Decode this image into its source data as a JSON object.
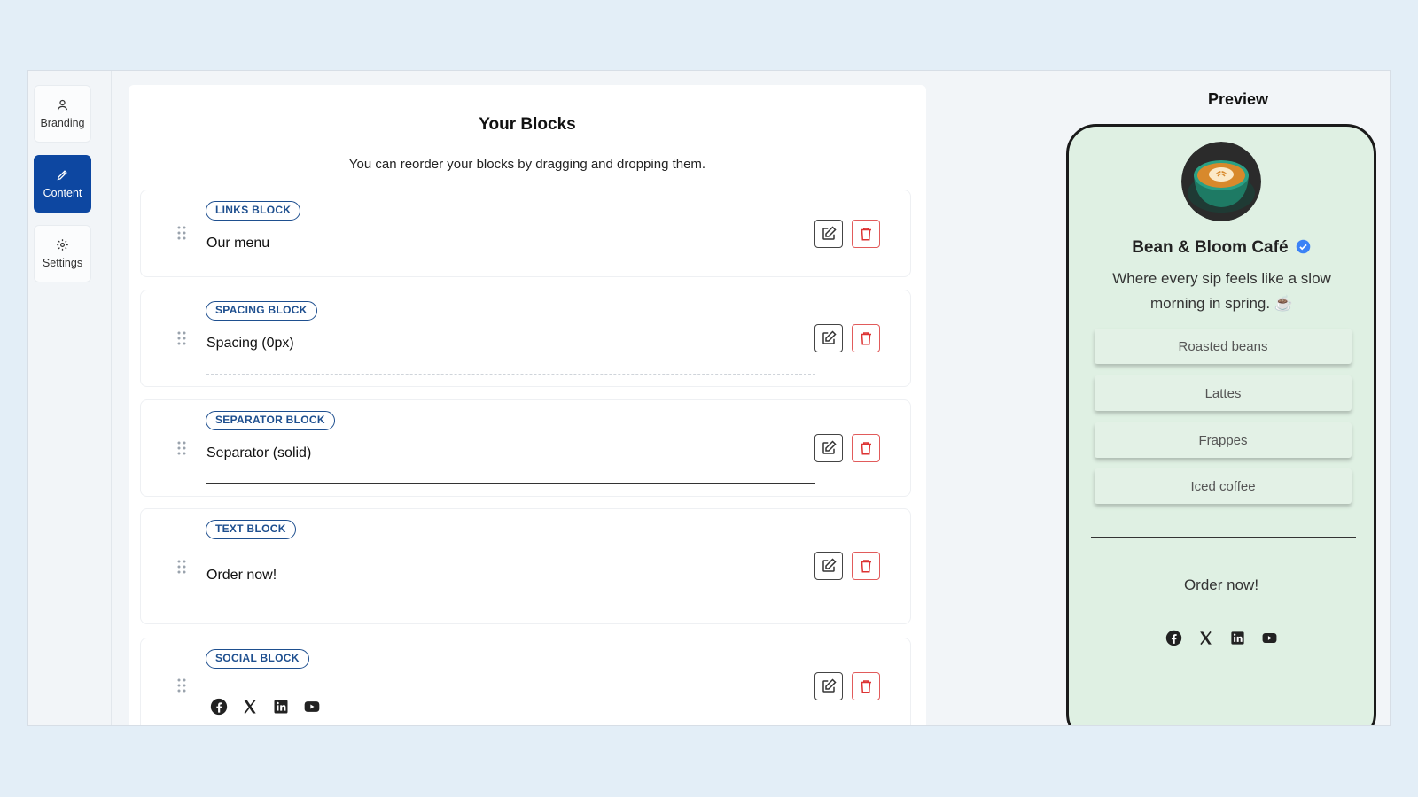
{
  "sidebar": {
    "items": [
      {
        "label": "Branding",
        "icon": "user-icon",
        "active": false
      },
      {
        "label": "Content",
        "icon": "pencil-icon",
        "active": true
      },
      {
        "label": "Settings",
        "icon": "gear-icon",
        "active": false
      }
    ]
  },
  "blocks_panel": {
    "title": "Your Blocks",
    "subtitle": "You can reorder your blocks by dragging and dropping them.",
    "blocks": [
      {
        "type_label": "LINKS BLOCK",
        "text": "Our menu"
      },
      {
        "type_label": "SPACING BLOCK",
        "text": "Spacing (0px)"
      },
      {
        "type_label": "SEPARATOR BLOCK",
        "text": "Separator (solid)"
      },
      {
        "type_label": "TEXT BLOCK",
        "text": "Order now!"
      },
      {
        "type_label": "SOCIAL BLOCK",
        "text": "",
        "icons": [
          "facebook-icon",
          "x-icon",
          "linkedin-icon",
          "youtube-icon"
        ]
      }
    ]
  },
  "preview": {
    "label": "Preview",
    "profile": {
      "name": "Bean & Bloom Café",
      "bio": "Where every sip feels like a slow morning in spring. ☕",
      "verified_color": "#3b82f6"
    },
    "links": [
      "Roasted beans",
      "Lattes",
      "Frappes",
      "Iced coffee"
    ],
    "text_block": "Order now!",
    "social_icons": [
      "facebook-icon",
      "x-icon",
      "linkedin-icon",
      "youtube-icon"
    ],
    "background_color": "#dff0e3"
  },
  "colors": {
    "accent": "#0d47a1",
    "badge": "#1e4f8f",
    "delete": "#e15b5b"
  }
}
